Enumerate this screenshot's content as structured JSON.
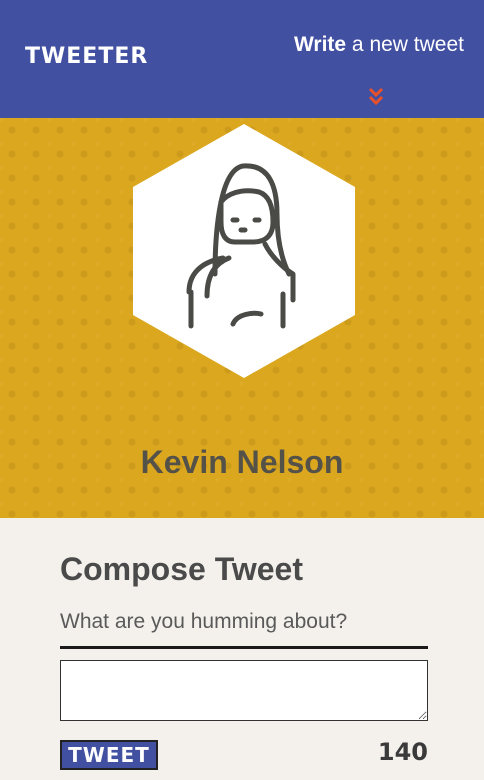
{
  "nav": {
    "brand": "TWEETER",
    "write_strong": "Write",
    "write_rest": " a new tweet",
    "toggle_icon": "double-chevron-down-icon",
    "toggle_color": "#e8502b"
  },
  "profile": {
    "name": "Kevin Nelson",
    "avatar_icon": "person-avatar-icon",
    "background_color": "#dba71e"
  },
  "compose": {
    "title": "Compose Tweet",
    "label": "What are you humming about?",
    "input_value": "",
    "button_label": "TWEET",
    "counter": "140"
  },
  "colors": {
    "nav": "#4250a2",
    "page_bg": "#f4f1ec"
  }
}
